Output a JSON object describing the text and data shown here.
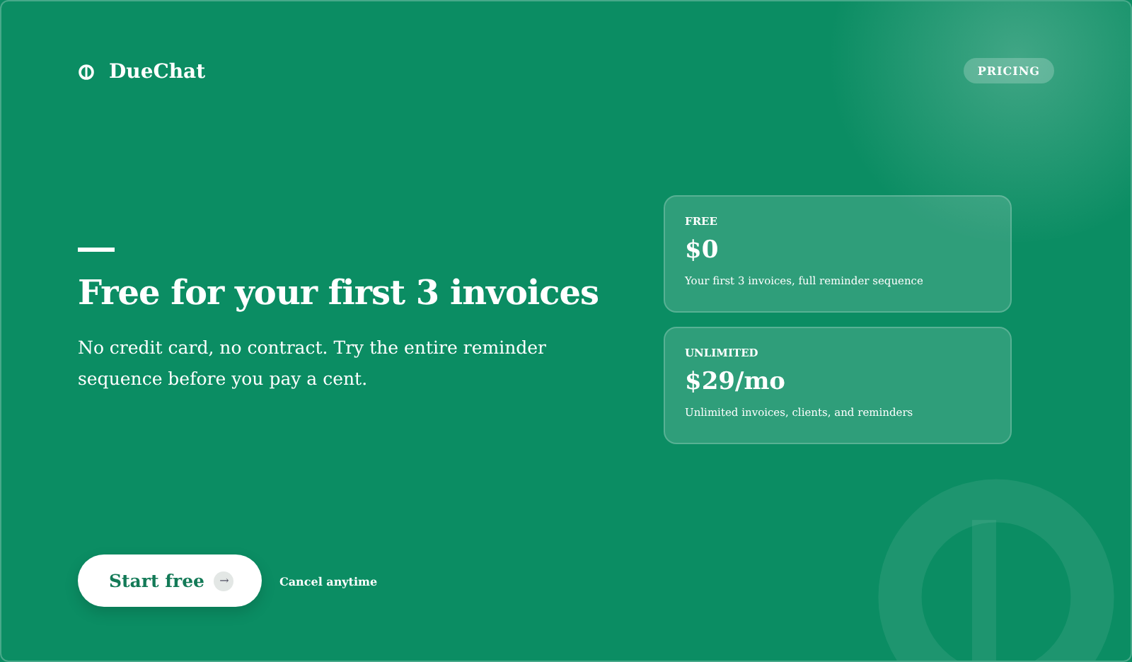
{
  "brand": {
    "name": "DueChat"
  },
  "nav": {
    "badge": "PRICING"
  },
  "hero": {
    "title": "Free for your first 3 invoices",
    "subtitle": "No credit card, no contract. Try the entire reminder sequence before you pay a cent."
  },
  "plans": [
    {
      "label": "FREE",
      "price": "$0",
      "description": "Your first 3 invoices, full reminder sequence"
    },
    {
      "label": "UNLIMITED",
      "price": "$29/mo",
      "description": "Unlimited invoices, clients, and reminders"
    }
  ],
  "cta": {
    "button": "Start free",
    "arrow": "→",
    "note": "Cancel anytime"
  }
}
